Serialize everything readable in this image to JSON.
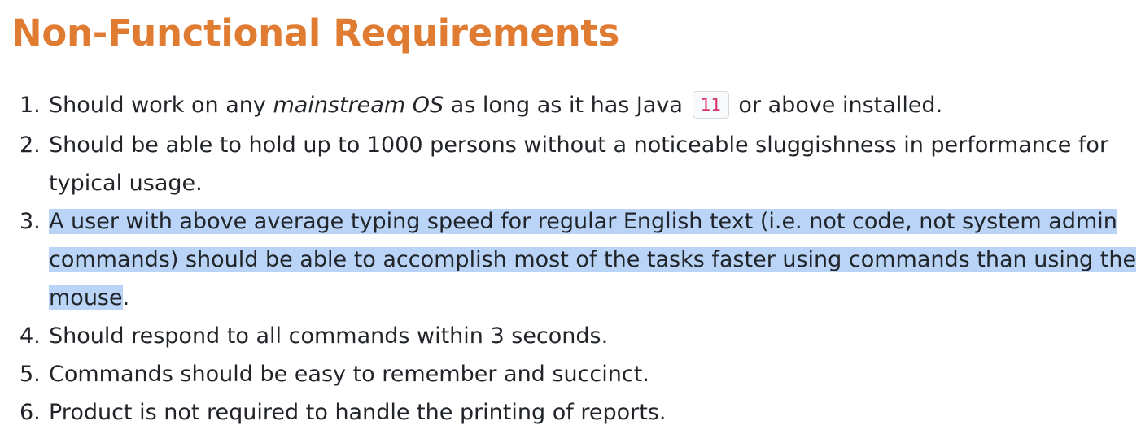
{
  "heading": "Non-Functional Requirements",
  "requirements": [
    {
      "num": "1.",
      "before": "Should work on any ",
      "emphasis": "mainstream OS",
      "middle": " as long as it has Java ",
      "code": "11",
      "after": " or above installed."
    },
    {
      "num": "2.",
      "text": "Should be able to hold up to 1000 persons without a noticeable sluggishness in performance for typical usage."
    },
    {
      "num": "3.",
      "selected_text": "A user with above average typing speed for regular English text (i.e. not code, not system admin commands) should be able to accomplish most of the tasks faster using commands than using the mouse",
      "after": "."
    },
    {
      "num": "4.",
      "text": "Should respond to all commands within 3 seconds."
    },
    {
      "num": "5.",
      "text": "Commands should be easy to remember and succinct."
    },
    {
      "num": "6.",
      "text": "Product is not required to handle the printing of reports."
    }
  ],
  "colors": {
    "heading": "#e07b32",
    "text": "#212529",
    "selection": "#b9d4f7",
    "code_text": "#d6336c"
  }
}
